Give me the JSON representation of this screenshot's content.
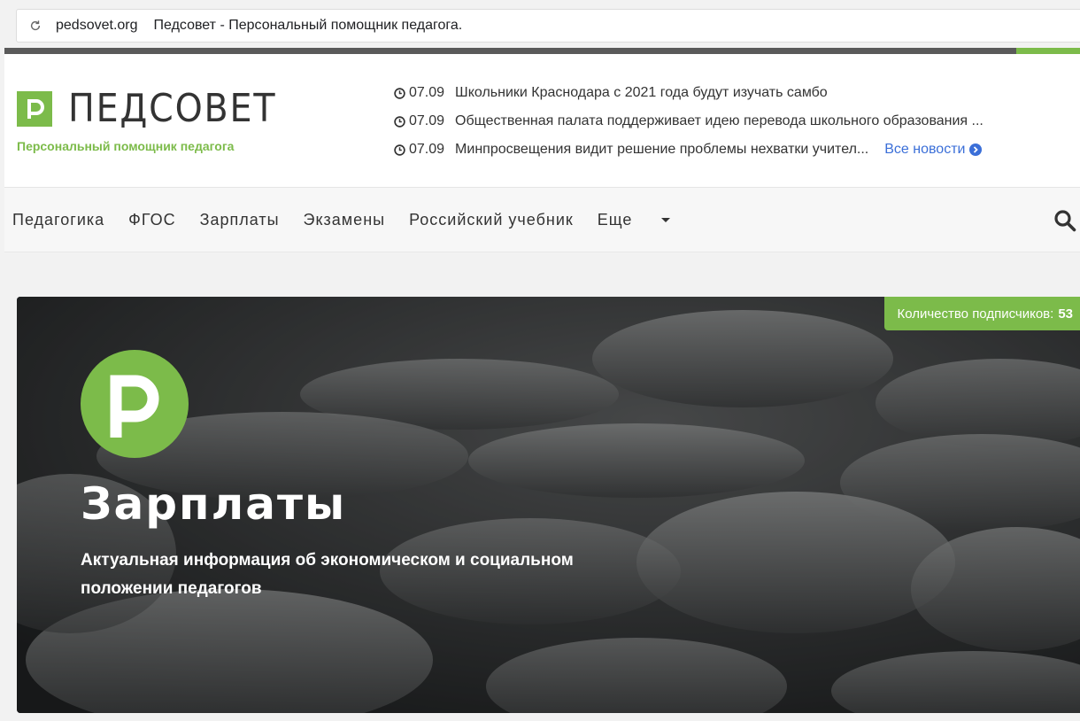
{
  "browser": {
    "url": "pedsovet.org",
    "page_title": "Педсовет - Персональный помощник педагога.",
    "reload_icon": "reload-icon"
  },
  "header": {
    "logo_text": "ПЕДСОВЕТ",
    "tagline": "Персональный помощник педагога",
    "news": [
      {
        "date": "07.09",
        "text": "Школьники Краснодара с 2021 года будут изучать самбо"
      },
      {
        "date": "07.09",
        "text": "Общественная палата поддерживает идею перевода школьного образования ..."
      },
      {
        "date": "07.09",
        "text": "Минпросвещения видит решение проблемы нехватки учител..."
      }
    ],
    "all_news_label": "Все новости"
  },
  "nav": {
    "items": [
      "Педагогика",
      "ФГОС",
      "Зарплаты",
      "Экзамены",
      "Российский учебник",
      "Еще"
    ],
    "search_icon": "search-icon"
  },
  "hero": {
    "subscribers_label": "Количество подписчиков:",
    "subscribers_count": "53",
    "title": "Зарплаты",
    "subtitle": "Актуальная информация об экономическом и социальном положении педагогов"
  },
  "colors": {
    "accent": "#7cbb4a",
    "link": "#3b6fd8",
    "text": "#333333"
  }
}
